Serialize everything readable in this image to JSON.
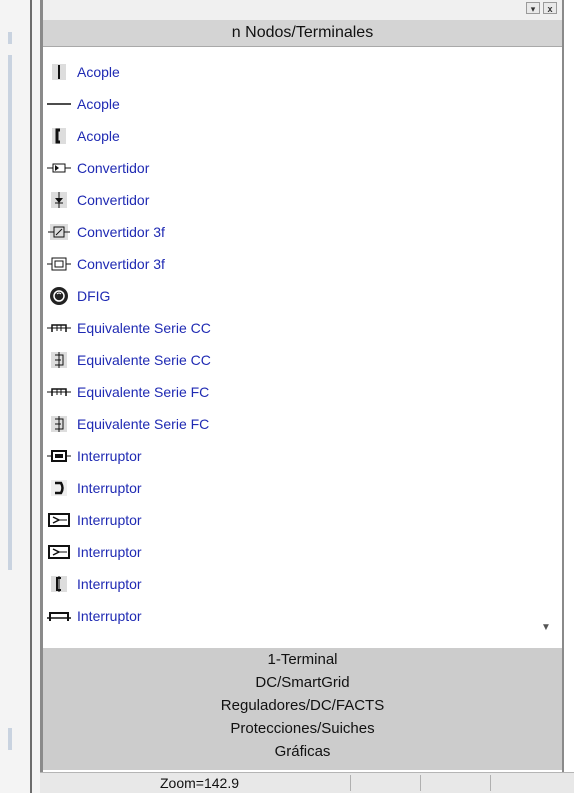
{
  "header": {
    "title": "n Nodos/Terminales"
  },
  "window_controls": {
    "dropdown_icon": "chevron-down-icon",
    "close_label": "x"
  },
  "items": [
    {
      "label": "Acople",
      "icon": "vertical-bar-icon"
    },
    {
      "label": "Acople",
      "icon": "horizontal-line-icon"
    },
    {
      "label": "Acople",
      "icon": "bracket-icon"
    },
    {
      "label": "Convertidor",
      "icon": "converter-horizontal-icon"
    },
    {
      "label": "Convertidor",
      "icon": "converter-vertical-icon"
    },
    {
      "label": "Convertidor 3f",
      "icon": "converter-3f-icon"
    },
    {
      "label": "Convertidor 3f",
      "icon": "converter-3f-box-icon"
    },
    {
      "label": "DFIG",
      "icon": "dfig-icon"
    },
    {
      "label": "Equivalente Serie CC",
      "icon": "series-equivalent-horizontal-icon"
    },
    {
      "label": "Equivalente Serie CC",
      "icon": "series-equivalent-vertical-icon"
    },
    {
      "label": "Equivalente Serie FC",
      "icon": "series-equivalent-horizontal-icon"
    },
    {
      "label": "Equivalente Serie FC",
      "icon": "series-equivalent-vertical-icon"
    },
    {
      "label": "Interruptor",
      "icon": "switch-box-icon"
    },
    {
      "label": "Interruptor",
      "icon": "switch-curve-icon"
    },
    {
      "label": "Interruptor",
      "icon": "switch-block-icon"
    },
    {
      "label": "Interruptor",
      "icon": "switch-block-icon"
    },
    {
      "label": "Interruptor",
      "icon": "switch-vertical-icon"
    },
    {
      "label": "Interruptor",
      "icon": "switch-horizontal-icon"
    }
  ],
  "scroll": {
    "icon": "scroll-down-arrow-icon"
  },
  "groups": [
    "1-Terminal",
    "DC/SmartGrid",
    "Reguladores/DC/FACTS",
    "Protecciones/Suiches",
    "Gráficas"
  ],
  "status": {
    "zoom": "Zoom=142.9"
  },
  "colors": {
    "item_text": "#1f2ab3",
    "header_bg": "#d4d4d4",
    "groups_bg": "#cccccc"
  }
}
